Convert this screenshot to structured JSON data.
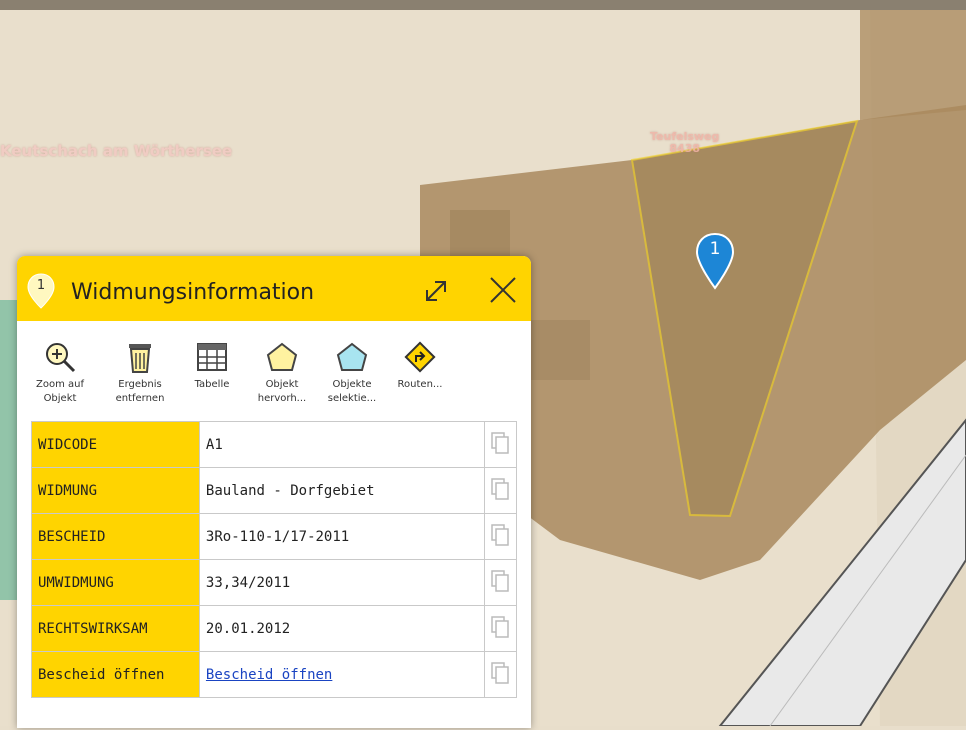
{
  "map": {
    "place_label": "Keutschach am Wörthersee",
    "parcel_label": "Teufelsweg\n8438",
    "marker_number": "1"
  },
  "popup": {
    "marker_number": "1",
    "title": "Widmungsinformation",
    "header_color": "#ffd400",
    "tools": [
      {
        "label": "Zoom auf\nObjekt",
        "icon": "zoom-in-icon"
      },
      {
        "label": "Ergebnis\nentfernen",
        "icon": "trash-icon"
      },
      {
        "label": "Tabelle",
        "icon": "table-icon"
      },
      {
        "label": "Objekt\nhervorh...",
        "icon": "highlight-polygon-icon"
      },
      {
        "label": "Objekte\nselektie...",
        "icon": "select-polygon-icon"
      },
      {
        "label": "Routen...",
        "icon": "route-icon"
      }
    ],
    "rows": [
      {
        "key": "WIDCODE",
        "value": "A1"
      },
      {
        "key": "WIDMUNG",
        "value": "Bauland - Dorfgebiet"
      },
      {
        "key": "BESCHEID",
        "value": "3Ro-110-1/17-2011"
      },
      {
        "key": "UMWIDMUNG",
        "value": "33,34/2011"
      },
      {
        "key": "RECHTSWIRKSAM",
        "value": "20.01.2012"
      },
      {
        "key": "Bescheid öffnen",
        "value": "Bescheid öffnen",
        "is_link": true
      }
    ]
  }
}
